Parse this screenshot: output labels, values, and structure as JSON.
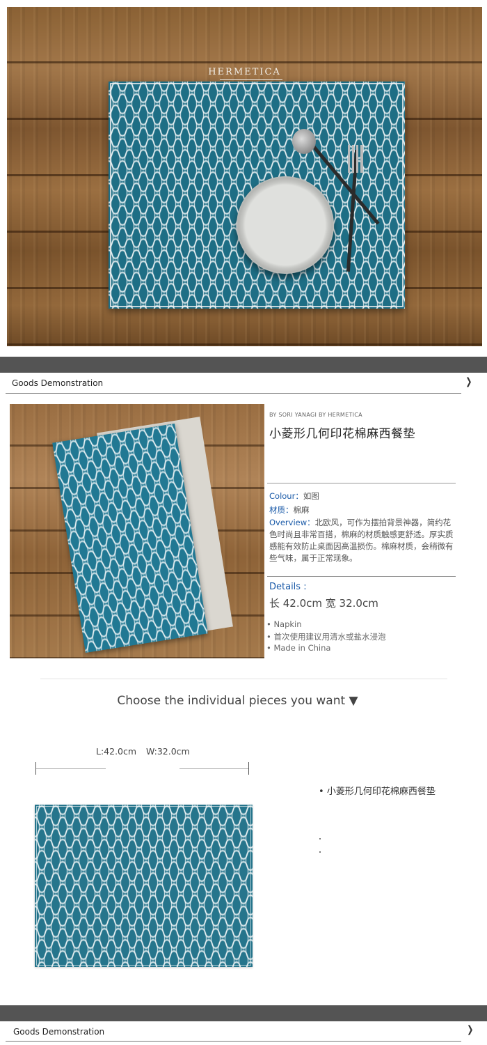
{
  "hero": {
    "brand": "HERMETICA"
  },
  "sections": {
    "demo_title": "Goods  Demonstration",
    "chevron": "❯"
  },
  "product": {
    "byline": "BY SORI YANAGI BY HERMETICA",
    "title": "小菱形几何印花棉麻西餐垫",
    "colour_key": "Colour：",
    "colour_val": "如图",
    "material_key": "材质：",
    "material_val": "棉麻",
    "overview_key": "Overview：",
    "overview_val": "北欧风，可作为摆拍背景神器，简约花色时尚且非常百搭，棉麻的材质触感更舒适。厚实质感能有效防止桌面因高温损伤。棉麻材质，会稍微有些气味，属于正常现象。",
    "details_key": "Details :",
    "dims": "长 42.0cm   宽 32.0cm",
    "bullets": [
      "Napkin",
      "首次使用建议用清水或盐水浸泡",
      "Made in China"
    ]
  },
  "choose": {
    "heading": "Choose the individual pieces you want ▼",
    "length": "L:42.0cm",
    "width": "W:32.0cm",
    "item": "小菱形几何印花棉麻西餐垫"
  },
  "colors": {
    "accent": "#1a5aa8",
    "bar": "#545454",
    "teal": "#26758c"
  }
}
